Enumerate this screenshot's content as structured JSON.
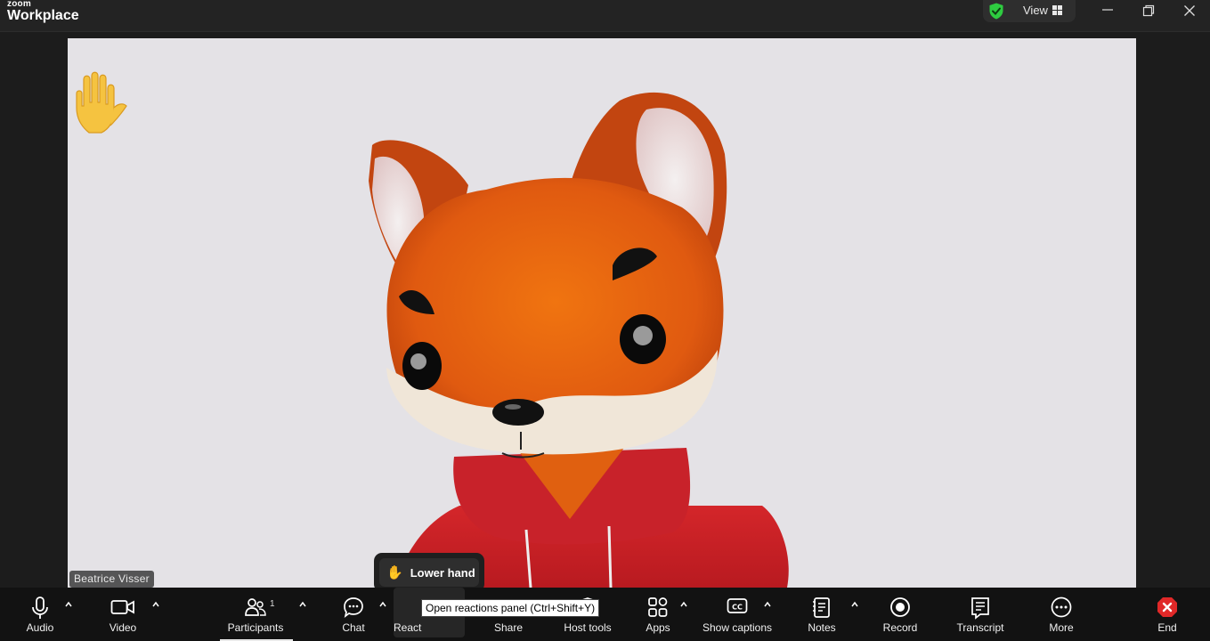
{
  "app": {
    "brand_top": "zoom",
    "brand_bottom": "Workplace",
    "view_label": "View"
  },
  "participant": {
    "name": "Beatrice Visser",
    "hand_raised": true
  },
  "reaction_popup": {
    "lower_hand_label": "Lower hand"
  },
  "tooltip": {
    "text": "Open reactions panel (Ctrl+Shift+Y)"
  },
  "toolbar": {
    "audio": "Audio",
    "video": "Video",
    "participants": "Participants",
    "participants_count": "1",
    "chat": "Chat",
    "react": "React",
    "share": "Share",
    "host_tools": "Host tools",
    "apps": "Apps",
    "show_captions": "Show captions",
    "notes": "Notes",
    "record": "Record",
    "transcript": "Transcript",
    "more": "More",
    "end": "End"
  },
  "colors": {
    "end_red": "#e02828",
    "shield_green": "#2ecc40",
    "stage_bg": "#e4e2e6"
  }
}
